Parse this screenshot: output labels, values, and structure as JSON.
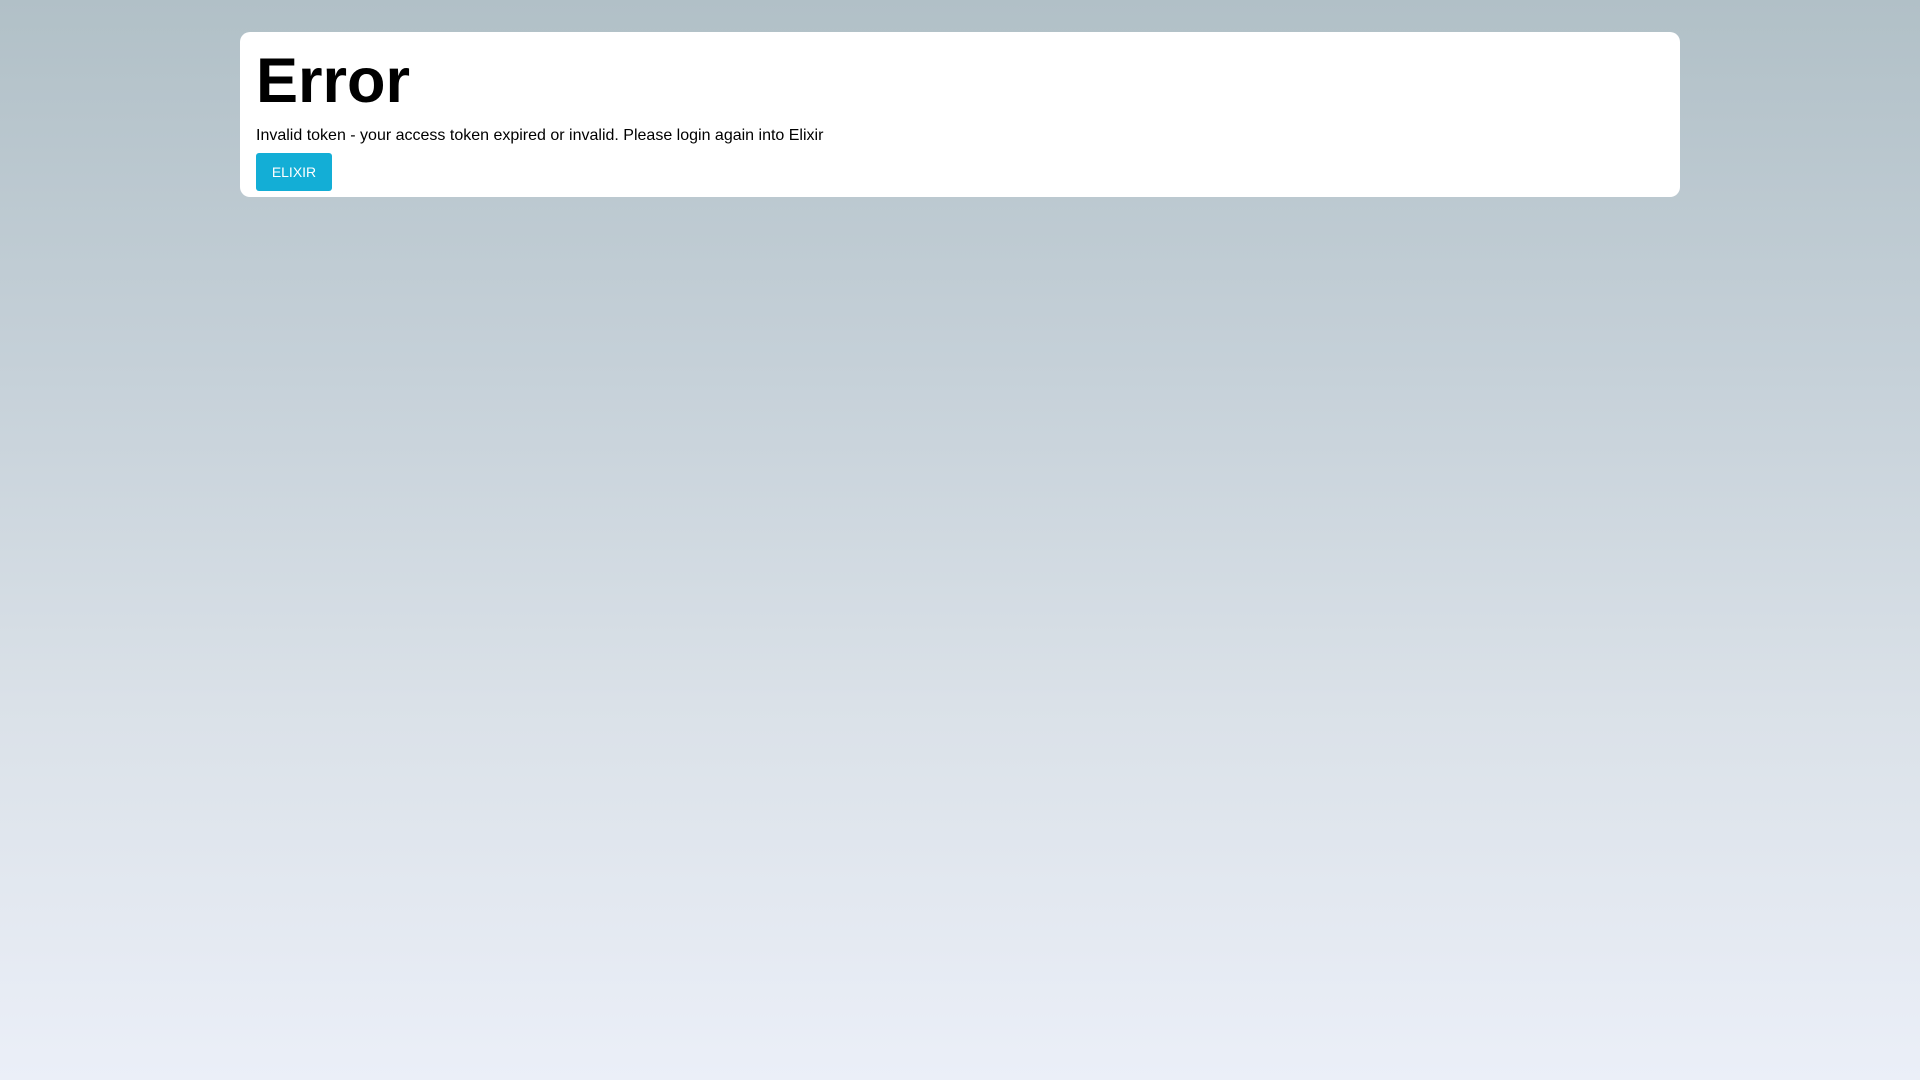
{
  "error": {
    "title": "Error",
    "message": "Invalid token - your access token expired or invalid. Please login again into Elixir",
    "button_label": "ELIXIR"
  },
  "colors": {
    "background_top": "#b1c0c7",
    "background_bottom": "#ebeff8",
    "card": "#ffffff",
    "button": "#13aed6",
    "button_text": "#ffffff"
  }
}
